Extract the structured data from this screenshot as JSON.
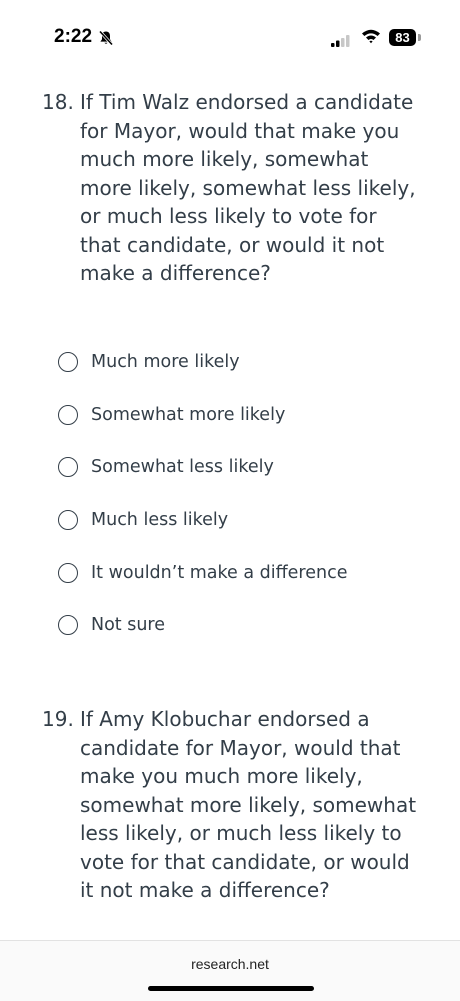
{
  "status_bar": {
    "time": "2:22",
    "battery": "83",
    "icons": [
      "bell-slash-icon",
      "cellular-signal-icon",
      "wifi-icon",
      "battery-icon"
    ]
  },
  "questions": [
    {
      "number": "18.",
      "text": "If Tim Walz endorsed a candidate for Mayor, would that make you much more likely, somewhat more likely, somewhat less likely, or much less likely to vote for that candidate, or would it not make a difference?",
      "options": [
        "Much more likely",
        "Somewhat more likely",
        "Somewhat less likely",
        "Much less likely",
        "It wouldn’t make a difference",
        "Not sure"
      ]
    },
    {
      "number": "19.",
      "text": "If Amy Klobuchar endorsed a candidate for Mayor, would that make you much more likely, somewhat more likely, somewhat less likely, or much less likely to vote for that candidate, or would it not make a difference?"
    }
  ],
  "browser": {
    "url": "research.net"
  }
}
